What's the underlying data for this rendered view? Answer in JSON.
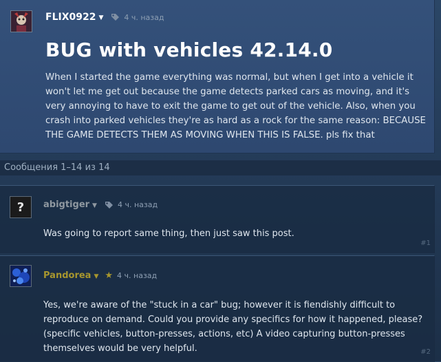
{
  "topic": {
    "author": "FLIX0922",
    "author_color": "#ffffff",
    "time": "4 ч. назад",
    "title": "BUG with vehicles 42.14.0",
    "body": "When I started the game everything was normal, but when I get into a vehicle it won't let me get out because the game detects parked cars as moving, and it's very annoying to have to exit the game to get out of the vehicle. Also, when you crash into parked vehicles they're as hard as a rock for the same reason: BECAUSE THE GAME DETECTS THEM AS MOVING WHEN THIS IS FALSE. pls fix that",
    "icon": "tag-icon"
  },
  "counter": "Сообщения 1–14 из 14",
  "comments": [
    {
      "author": "abigtiger",
      "author_color": "#8f98a0",
      "time": "4 ч. назад",
      "avatar_glyph": "?",
      "icon": "tag-icon",
      "text": "Was going to report same thing, then just saw this post.",
      "number": "#1"
    },
    {
      "author": "Pandorea",
      "author_color": "#a7962e",
      "time": "4 ч. назад",
      "icon": "star-icon",
      "star": "★",
      "text": "Yes, we're aware of the \"stuck in a car\" bug; however it is fiendishly difficult to reproduce on demand. Could you provide any specifics for how it happened, please? (specific vehicles, button-presses, actions, etc) A video capturing button-presses themselves would be very helpful.",
      "number": "#2"
    }
  ]
}
